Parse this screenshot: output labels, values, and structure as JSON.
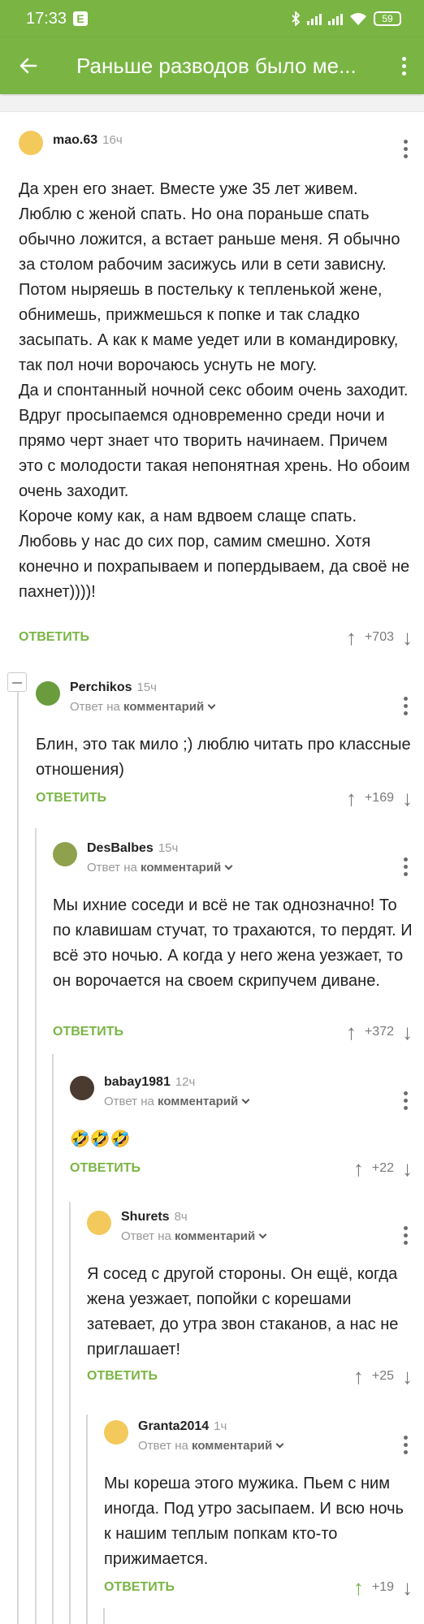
{
  "status": {
    "time": "17:33",
    "notif": "E",
    "battery": "59"
  },
  "header": {
    "title": "Раньше разводов было ме..."
  },
  "comments": [
    {
      "user": "mao.63",
      "time": "16ч",
      "reply_prefix": "",
      "reply_target": "",
      "text": "Да хрен его знает. Вместе уже 35 лет живем. Люблю с женой спать. Но  она пораньше спать обычно ложится, а встает раньше меня.  Я обычно за столом рабочим засижусь или в сети зависну.  Потом ныряешь в постельку к тепленькой жене, обнимешь, прижмешься к попке и так сладко засыпать. А как к маме уедет или в командировку, так пол ночи ворочаюсь уснуть не могу.\n Да и спонтанный ночной секс обоим очень заходит. Вдруг просыпаемся одновременно среди ночи и прямо черт знает что творить начинаем. Причем это с молодости такая непонятная хрень. Но обоим очень заходит.\n Короче кому как, а нам вдвоем слаще спать. Любовь у нас до сих пор, самим смешно. Хотя конечно и похрапываем и попердываем, да своё не пахнет))))!",
      "reply_label": "ОТВЕТИТЬ",
      "votes": "+703",
      "avatar_color": "#f3c95c"
    },
    {
      "user": "Perchikos",
      "time": "15ч",
      "reply_prefix": "Ответ на",
      "reply_target": "комментарий",
      "text": "Блин, это так мило ;) люблю читать про классные отношения)",
      "reply_label": "ОТВЕТИТЬ",
      "votes": "+169",
      "avatar_color": "#6a9b3c"
    },
    {
      "user": "DesBalbes",
      "time": "15ч",
      "reply_prefix": "Ответ на",
      "reply_target": "комментарий",
      "text": "Мы ихние соседи и всё не так однозначно! То по клавишам стучат, то трахаются, то пердят. И всё это ночью. А когда у него жена уезжает, то он ворочается на своем скрипучем диване.",
      "reply_label": "ОТВЕТИТЬ",
      "votes": "+372",
      "avatar_color": "#8fa14d"
    },
    {
      "user": "babay1981",
      "time": "12ч",
      "reply_prefix": "Ответ на",
      "reply_target": "комментарий",
      "text": "🤣🤣🤣",
      "reply_label": "ОТВЕТИТЬ",
      "votes": "+22",
      "avatar_color": "#4a3a30"
    },
    {
      "user": "Shurets",
      "time": "8ч",
      "reply_prefix": "Ответ на",
      "reply_target": "комментарий",
      "text": "Я сосед с другой стороны. Он ещё, когда жена уезжает, попойки с корешами затевает, до утра звон стаканов, а нас не приглашает!",
      "reply_label": "ОТВЕТИТЬ",
      "votes": "+25",
      "avatar_color": "#f3c95c"
    },
    {
      "user": "Granta2014",
      "time": "1ч",
      "reply_prefix": "Ответ на",
      "reply_target": "комментарий",
      "text": "Мы кореша этого мужика. Пьем с ним иногда. Под утро засыпаем. И всю ночь к нашим теплым попкам кто-то прижимается.",
      "reply_label": "ОТВЕТИТЬ",
      "votes": "+19",
      "avatar_color": "#f3c95c"
    }
  ]
}
